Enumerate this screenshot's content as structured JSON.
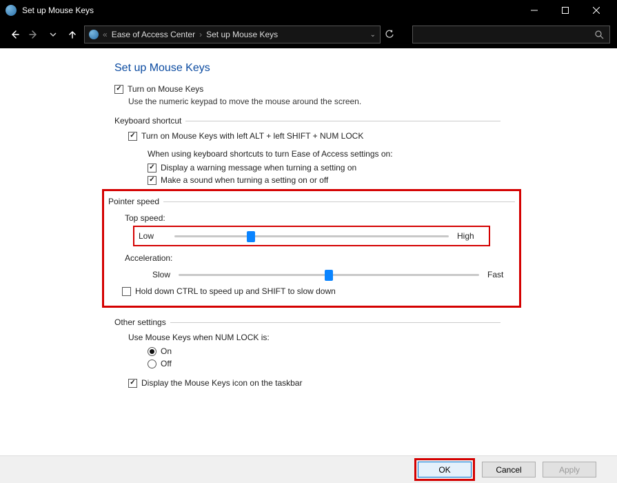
{
  "window": {
    "title": "Set up Mouse Keys"
  },
  "breadcrumbs": {
    "seg1": "Ease of Access Center",
    "seg2": "Set up Mouse Keys",
    "chevrons": "«"
  },
  "page": {
    "title": "Set up Mouse Keys",
    "turn_on_label": "Turn on Mouse Keys",
    "turn_on_desc": "Use the numeric keypad to move the mouse around the screen."
  },
  "keyboard_shortcut": {
    "legend": "Keyboard shortcut",
    "enable_label": "Turn on Mouse Keys with left ALT + left SHIFT + NUM LOCK",
    "when_using": "When using keyboard shortcuts to turn Ease of Access settings on:",
    "warning_label": "Display a warning message when turning a setting on",
    "sound_label": "Make a sound when turning a setting on or off"
  },
  "pointer_speed": {
    "legend": "Pointer speed",
    "top_speed_label": "Top speed:",
    "low": "Low",
    "high": "High",
    "top_speed_pct": 28,
    "acceleration_label": "Acceleration:",
    "slow": "Slow",
    "fast": "Fast",
    "acceleration_pct": 50,
    "hold_ctrl_label": "Hold down CTRL to speed up and SHIFT to slow down"
  },
  "other": {
    "legend": "Other settings",
    "use_when_label": "Use Mouse Keys when NUM LOCK is:",
    "on": "On",
    "off": "Off",
    "taskbar_label": "Display the Mouse Keys icon on the taskbar"
  },
  "buttons": {
    "ok": "OK",
    "cancel": "Cancel",
    "apply": "Apply"
  }
}
